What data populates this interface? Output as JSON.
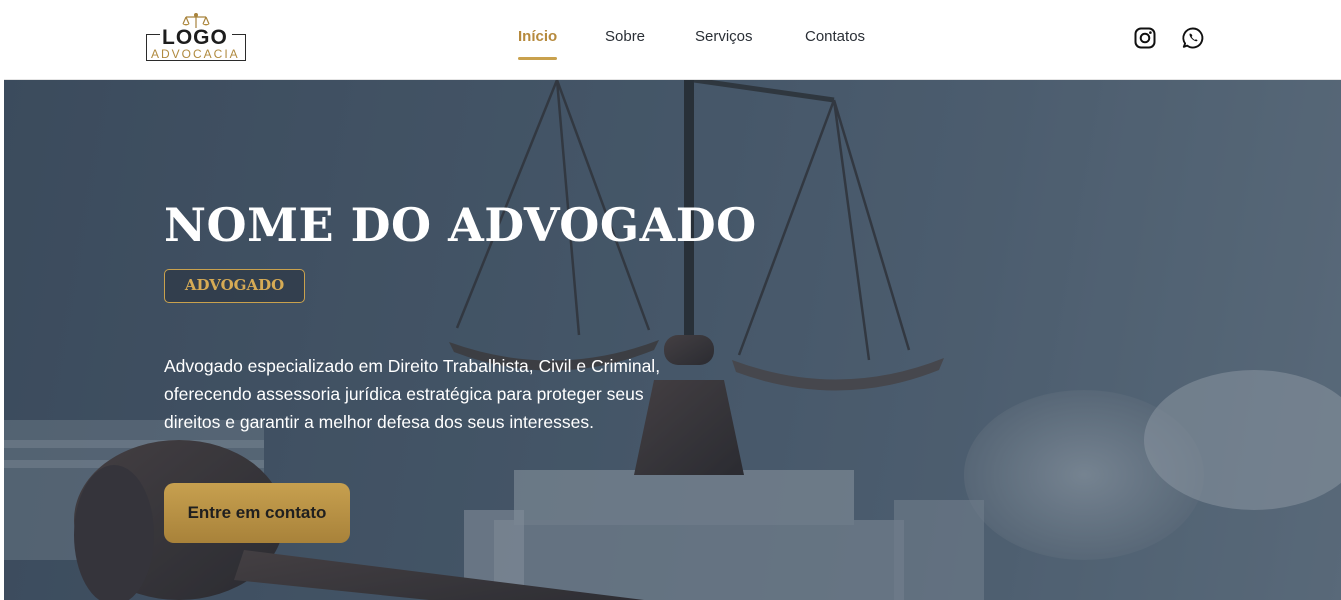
{
  "header": {
    "logo": {
      "main": "LOGO",
      "sub": "ADVOCACIA"
    },
    "nav": [
      {
        "label": "Início",
        "active": true
      },
      {
        "label": "Sobre",
        "active": false
      },
      {
        "label": "Serviços",
        "active": false
      },
      {
        "label": "Contatos",
        "active": false
      }
    ],
    "social": [
      "instagram-icon",
      "whatsapp-icon"
    ]
  },
  "hero": {
    "title": "NOME DO ADVOGADO",
    "badge": "ADVOGADO",
    "description": "Advogado especializado em Direito Trabalhista, Civil e Criminal, oferecendo assessoria jurídica estratégica para proteger seus direitos e garantir a melhor defesa dos seus interesses.",
    "cta_label": "Entre em contato"
  },
  "colors": {
    "accent": "#c9a14d",
    "hero_overlay": "#44556a",
    "nav_text": "#2a2f36"
  }
}
